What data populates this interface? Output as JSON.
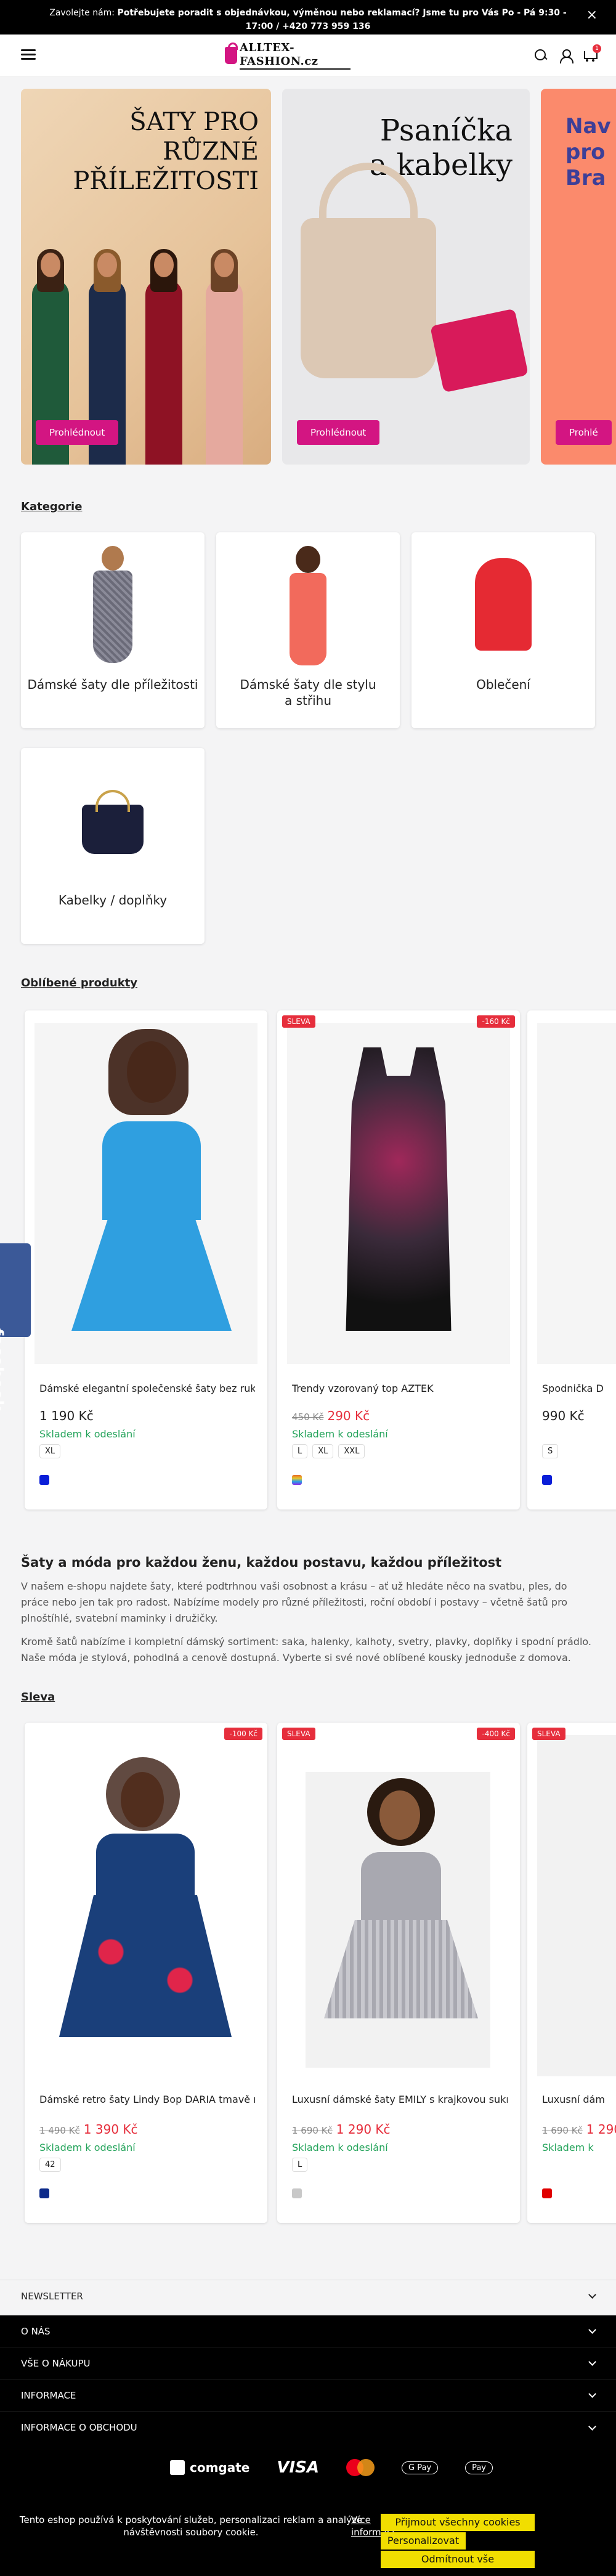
{
  "announcement": {
    "prefix": "Zavolejte nám: ",
    "bold": "Potřebujete poradit s objednávkou, výměnou nebo reklamací? Jsme tu pro Vás Po - Pá 9:30 - 17:00 / +420 773 959 136",
    "close": "×"
  },
  "header": {
    "logo_text": "ALLTEX-FASHION.cz",
    "cart_count": "1"
  },
  "banners": [
    {
      "title_lines": [
        "ŠATY PRO",
        "RŮZNÉ",
        "PŘÍLEŽITOSTI"
      ],
      "button": "Prohlédnout"
    },
    {
      "title_lines": [
        "Psaníčka",
        "a kabelky"
      ],
      "button": "Prohlédnout"
    },
    {
      "title_lines": [
        "Nav",
        "pro",
        "Bra"
      ],
      "button": "Prohlé"
    }
  ],
  "categories_title": "Kategorie",
  "categories": [
    {
      "label": "Dámské šaty dle příležitosti"
    },
    {
      "label": "Dámské šaty dle stylu a střihu"
    },
    {
      "label": "Oblečení"
    },
    {
      "label": "Kabelky / doplňky"
    }
  ],
  "popular_title": "Oblíbené produkty",
  "popular": [
    {
      "name": "Dámské elegantní společenské šaty bez rukávu",
      "price": "1 190 Kč",
      "old_price": "",
      "stock": "Skladem k odeslání",
      "sizes": [
        "XL"
      ],
      "tags": [],
      "swatch": "#0a1ed8"
    },
    {
      "name": "Trendy vzorovaný top AZTEK",
      "price": "290 Kč",
      "old_price": "450 Kč",
      "stock": "Skladem k odeslání",
      "sizes": [
        "L",
        "XL",
        "XXL"
      ],
      "tags": [
        "SLEVA",
        "-160 Kč"
      ],
      "swatch": "#e86a2a"
    },
    {
      "name": "Spodnička D",
      "price": "990 Kč",
      "old_price": "",
      "stock": "",
      "sizes": [
        "S"
      ],
      "tags": [],
      "swatch": "#0a1ed8"
    }
  ],
  "seo": {
    "heading": "Šaty a móda pro každou ženu, každou postavu, každou příležitost",
    "p1": "V našem e-shopu najdete šaty, které podtrhnou vaši osobnost a krásu – ať už hledáte něco na svatbu, ples, do práce nebo jen tak pro radost. Nabízíme modely pro různé příležitosti, roční období i postavy – včetně šatů pro plnoštíhlé, svatební maminky i družičky.",
    "p2": "Kromě šatů nabízíme i kompletní dámský sortiment: saka, halenky, kalhoty, svetry, plavky, doplňky i spodní prádlo. Naše móda je stylová, pohodlná a cenově dostupná. Vyberte si své nové oblíbené kousky jednoduše z domova."
  },
  "sale_title": "Sleva",
  "sale": [
    {
      "name": "Dámské retro šaty Lindy Bop DARIA tmavě modré",
      "price": "1 390 Kč",
      "old_price": "1 490 Kč",
      "stock": "Skladem k odeslání",
      "sizes": [
        "42"
      ],
      "tags": [
        "-100 Kč"
      ],
      "swatch": "#0c2a8a"
    },
    {
      "name": "Luxusní dámské šaty EMILY s krajkovou sukní šedé",
      "price": "1 290 Kč",
      "old_price": "1 690 Kč",
      "stock": "Skladem k odeslání",
      "sizes": [
        "L"
      ],
      "tags": [
        "SLEVA",
        "-400 Kč"
      ],
      "swatch": "#c8c8c8"
    },
    {
      "name": "Luxusní dám",
      "price": "1 290",
      "old_price": "1 690 Kč",
      "stock": "Skladem k",
      "sizes": [],
      "tags": [
        "SLEVA"
      ],
      "swatch": "#e00000"
    }
  ],
  "accordion": {
    "newsletter": "NEWSLETTER",
    "o_nas": "O NÁS",
    "vse_o_nakupu": "VŠE O NÁKUPU",
    "informace": "INFORMACE",
    "informace_o_obchodu": "INFORMACE O OBCHODU"
  },
  "payments": {
    "comgate": "comgate",
    "visa": "VISA",
    "gpay": "G Pay",
    "applepay": "Pay"
  },
  "cookie": {
    "message": "Tento eshop používá k poskytování služeb, personalizaci reklam a analýze návštěvnosti soubory cookie.",
    "more": "Více informací",
    "accept_all": "Přijmout všechny cookies",
    "personalize": "Personalizovat",
    "reject_all": "Odmítnout vše"
  },
  "facebook_tab": "facebook"
}
